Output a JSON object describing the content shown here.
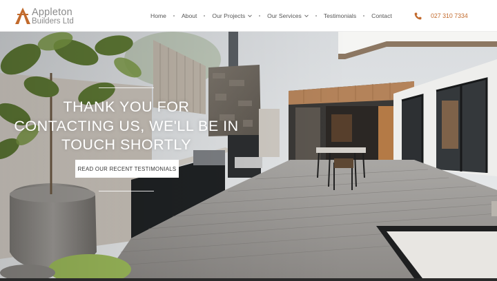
{
  "brand": {
    "name": "Appleton",
    "subtitle": "Builders Ltd"
  },
  "nav": {
    "items": [
      {
        "label": "Home",
        "dropdown": false
      },
      {
        "label": "About",
        "dropdown": false
      },
      {
        "label": "Our Projects",
        "dropdown": true
      },
      {
        "label": "Our Services",
        "dropdown": true
      },
      {
        "label": "Testimonials",
        "dropdown": false
      },
      {
        "label": "Contact",
        "dropdown": false
      }
    ]
  },
  "contact": {
    "phone": "027 310 7334",
    "icon": "phone-icon"
  },
  "hero": {
    "headline": "THANK YOU FOR CONTACTING US, WE'LL BE IN TOUCH SHORTLY",
    "cta_label": "READ OUR RECENT TESTIMONIALS"
  },
  "colors": {
    "accent": "#c26a2c",
    "nav_text": "#555555",
    "logo_text": "#8a8a8a"
  }
}
